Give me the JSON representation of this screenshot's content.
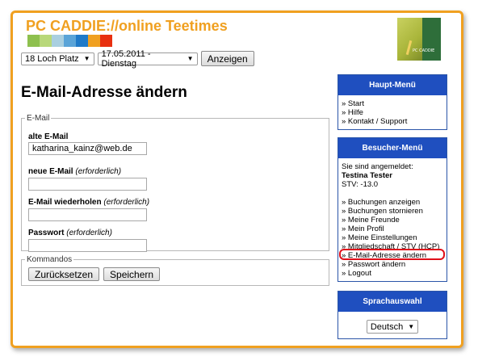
{
  "header": {
    "site_title": "PC CADDIE://online Teetimes",
    "swatch_colors": [
      "#8ec04e",
      "#b8d87a",
      "#a9cfe0",
      "#5aa4d8",
      "#1f7ac8",
      "#f0a020",
      "#e83010"
    ],
    "logo_text": "PC CADDIE"
  },
  "controls": {
    "course_select": "18 Loch Platz",
    "date_select": "17.05.2011 - Dienstag",
    "show_button": "Anzeigen"
  },
  "main": {
    "page_title": "E-Mail-Adresse ändern",
    "email_fieldset": {
      "legend": "E-Mail",
      "old_email_label": "alte E-Mail",
      "old_email_value": "katharina_kainz@web.de",
      "new_email_label": "neue E-Mail",
      "new_email_hint": "(erforderlich)",
      "new_email_value": "",
      "repeat_email_label": "E-Mail wiederholen",
      "repeat_email_hint": "(erforderlich)",
      "repeat_email_value": "",
      "password_label": "Passwort",
      "password_hint": "(erforderlich)",
      "password_value": ""
    },
    "commands_fieldset": {
      "legend": "Kommandos",
      "reset_button": "Zurücksetzen",
      "save_button": "Speichern"
    }
  },
  "sidebar": {
    "main_menu": {
      "title": "Haupt-Menü",
      "items": [
        "» Start",
        "» Hilfe",
        "» Kontakt / Support"
      ]
    },
    "visitor_menu": {
      "title": "Besucher-Menü",
      "logged_in_label": "Sie sind angemeldet:",
      "user_name": "Testina Tester",
      "handicap": "STV: -13.0",
      "items": [
        "» Buchungen anzeigen",
        "» Buchungen stornieren",
        "» Meine Freunde",
        "» Mein Profil",
        "» Meine Einstellungen",
        "» Mitgliedschaft / STV (HCP)",
        "» E-Mail-Adresse ändern",
        "» Passwort ändern",
        "» Logout"
      ]
    },
    "language": {
      "title": "Sprachauswahl",
      "selected": "Deutsch"
    }
  },
  "accent_colors": {
    "frame": "#f0a020",
    "panel_header": "#1f4fbf",
    "highlight": "#e0101a"
  }
}
